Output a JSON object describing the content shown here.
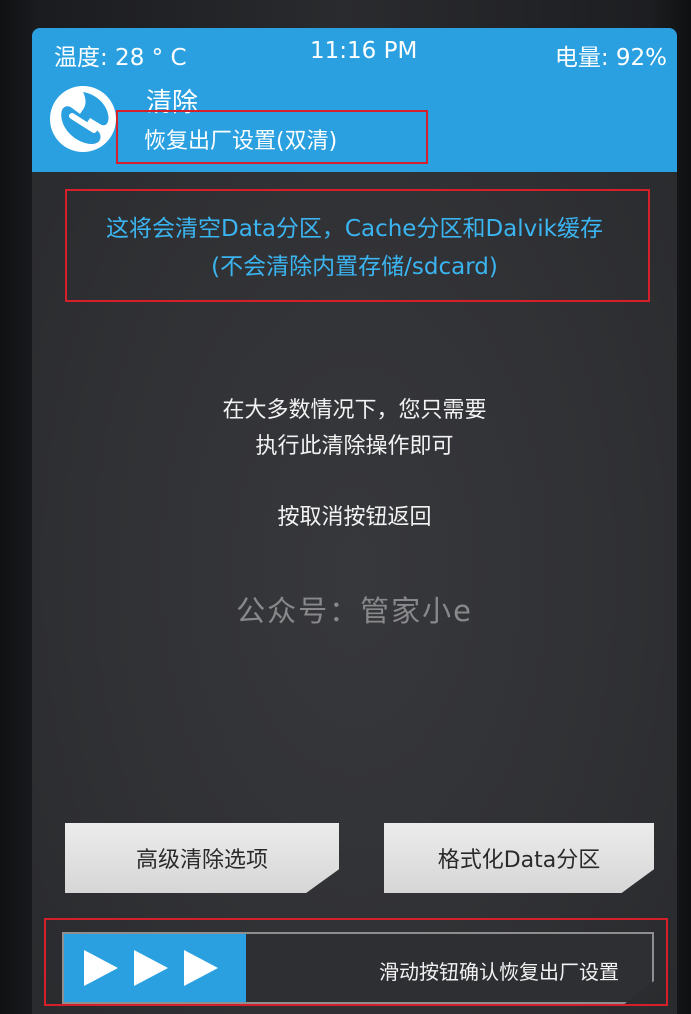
{
  "status_bar": {
    "temperature": "温度: 28 ° C",
    "time": "11:16 PM",
    "battery": "电量: 92%"
  },
  "header": {
    "title": "清除",
    "subtitle": "恢复出厂设置(双清)",
    "logo_icon": "twrp-logo-icon"
  },
  "warning": {
    "line1": "这将会清空Data分区，Cache分区和Dalvik缓存",
    "line2": "(不会清除内置存储/sdcard)"
  },
  "info": {
    "line1": "在大多数情况下，您只需要",
    "line2": "执行此清除操作即可",
    "line3": "按取消按钮返回"
  },
  "watermark": "公众号：管家小e",
  "buttons": {
    "advanced_wipe": "高级清除选项",
    "format_data": "格式化Data分区"
  },
  "slider": {
    "label": "滑动按钮确认恢复出厂设置",
    "handle_icon": "triple-arrow-right-icon"
  },
  "colors": {
    "accent": "#2aa0e0",
    "warning_text": "#3bb5f1",
    "highlight_box": "#d3202a"
  }
}
